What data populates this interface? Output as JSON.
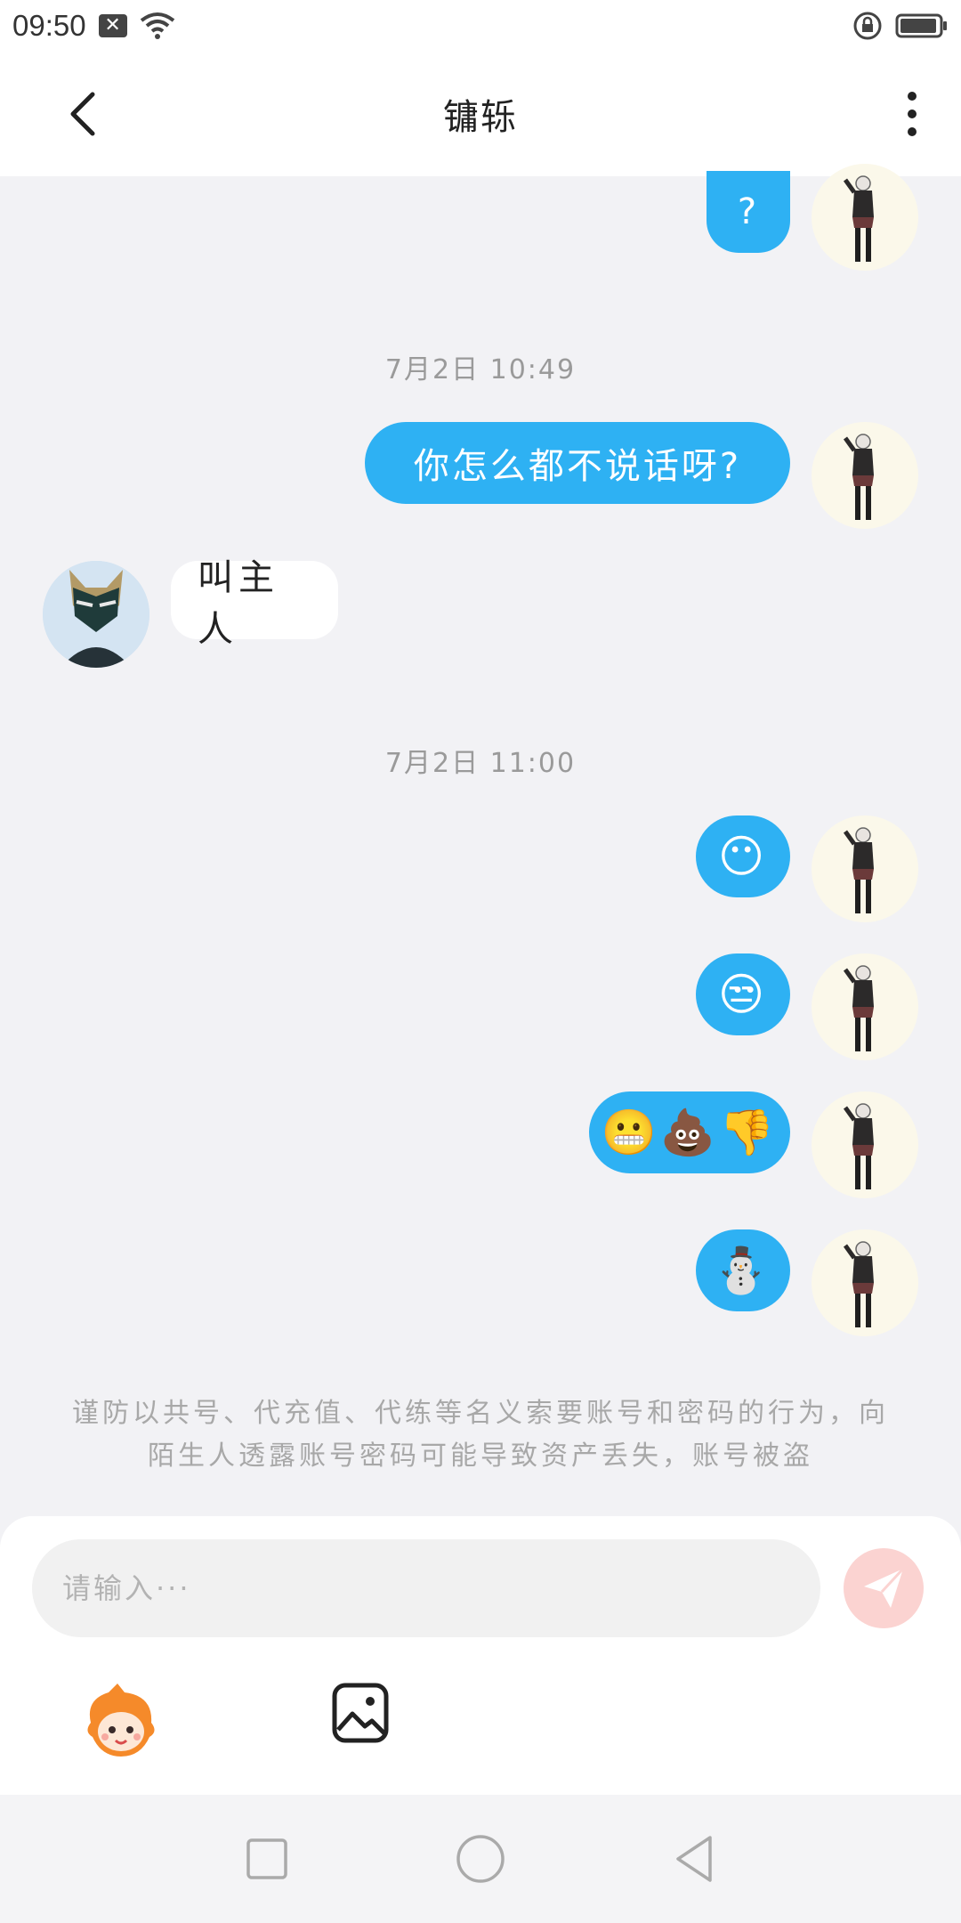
{
  "status_bar": {
    "time": "09:50"
  },
  "header": {
    "title": "镛轹"
  },
  "messages": [
    {
      "from": "me",
      "text": "?"
    },
    {
      "timestamp": "7月2日  10:49"
    },
    {
      "from": "me",
      "text": "你怎么都不说话呀?"
    },
    {
      "from": "other",
      "text": "叫主人"
    },
    {
      "timestamp": "7月2日  11:00"
    },
    {
      "from": "me",
      "text": "😶"
    },
    {
      "from": "me",
      "text": "😒"
    },
    {
      "from": "me",
      "text": "😬💩👎"
    },
    {
      "from": "me",
      "text": "⛄"
    }
  ],
  "warning": "谨防以共号、代充值、代练等名义索要账号和密码的行为，向陌生人透露账号密码可能导致资产丢失，账号被盗",
  "input": {
    "placeholder": "请输入···",
    "value": ""
  },
  "colors": {
    "bubble_me": "#2eb1f3",
    "send_button": "#fbd3d1",
    "background": "#f2f2f5"
  },
  "icons": {
    "back": "chevron-left-icon",
    "more": "more-vertical-icon",
    "send": "send-icon",
    "sticker": "sticker-icon",
    "image": "image-icon"
  }
}
